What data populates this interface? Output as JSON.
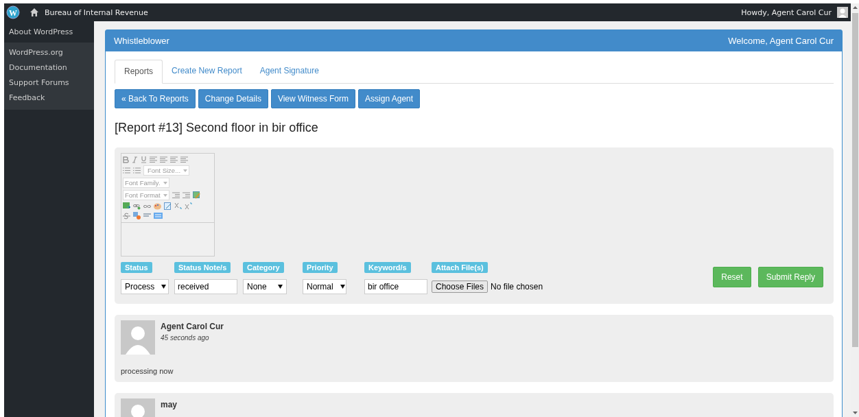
{
  "admin_bar": {
    "logo_letter": "W",
    "site_name": "Bureau of Internal Revenue",
    "greeting": "Howdy, Agent Carol Cur"
  },
  "sidebar": {
    "items": [
      {
        "label": "About WordPress",
        "kind": "header"
      },
      {
        "label": "WordPress.org",
        "kind": "link"
      },
      {
        "label": "Documentation",
        "kind": "link"
      },
      {
        "label": "Support Forums",
        "kind": "link"
      },
      {
        "label": "Feedback",
        "kind": "link"
      }
    ]
  },
  "panel": {
    "title": "Whistleblower",
    "welcome": "Welcome, Agent Carol Cur"
  },
  "tabs": [
    {
      "label": "Reports",
      "selected": true
    },
    {
      "label": "Create New Report",
      "selected": false
    },
    {
      "label": "Agent Signature",
      "selected": false
    }
  ],
  "action_buttons": [
    "« Back To Reports",
    "Change Details",
    "View Witness Form",
    "Assign Agent"
  ],
  "report_title": "[Report #13] Second floor in bir office",
  "editor": {
    "dropdowns": [
      "Font Size...",
      "Font Family.",
      "Font Format"
    ]
  },
  "fields": [
    {
      "label": "Status",
      "kind": "select",
      "value": "Process"
    },
    {
      "label": "Status Note/s",
      "kind": "text",
      "value": "received"
    },
    {
      "label": "Category",
      "kind": "select",
      "value": "None"
    },
    {
      "label": "Priority",
      "kind": "select",
      "value": "Normal"
    },
    {
      "label": "Keyword/s",
      "kind": "text",
      "value": "bir office"
    },
    {
      "label": "Attach File(s)",
      "kind": "file",
      "button": "Choose Files",
      "value": "No file chosen"
    }
  ],
  "form_buttons": [
    "Reset",
    "Submit Reply"
  ],
  "comments": [
    {
      "author": "Agent Carol Cur",
      "time": "45 seconds ago",
      "text": "processing now"
    },
    {
      "author": "may"
    }
  ]
}
